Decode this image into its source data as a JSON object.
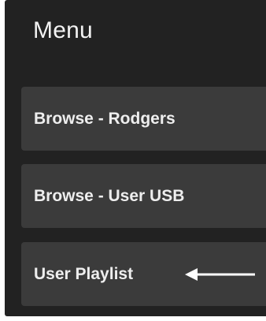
{
  "menu": {
    "title": "Menu",
    "items": [
      {
        "label": "Browse - Rodgers"
      },
      {
        "label": "Browse - User USB"
      },
      {
        "label": "User Playlist"
      }
    ]
  },
  "annotation": {
    "icon": "arrow-left-icon",
    "color": "#ffffff"
  },
  "colors": {
    "panel_background": "#222222",
    "item_background": "#3b3b3b",
    "text": "#eeeeee"
  }
}
